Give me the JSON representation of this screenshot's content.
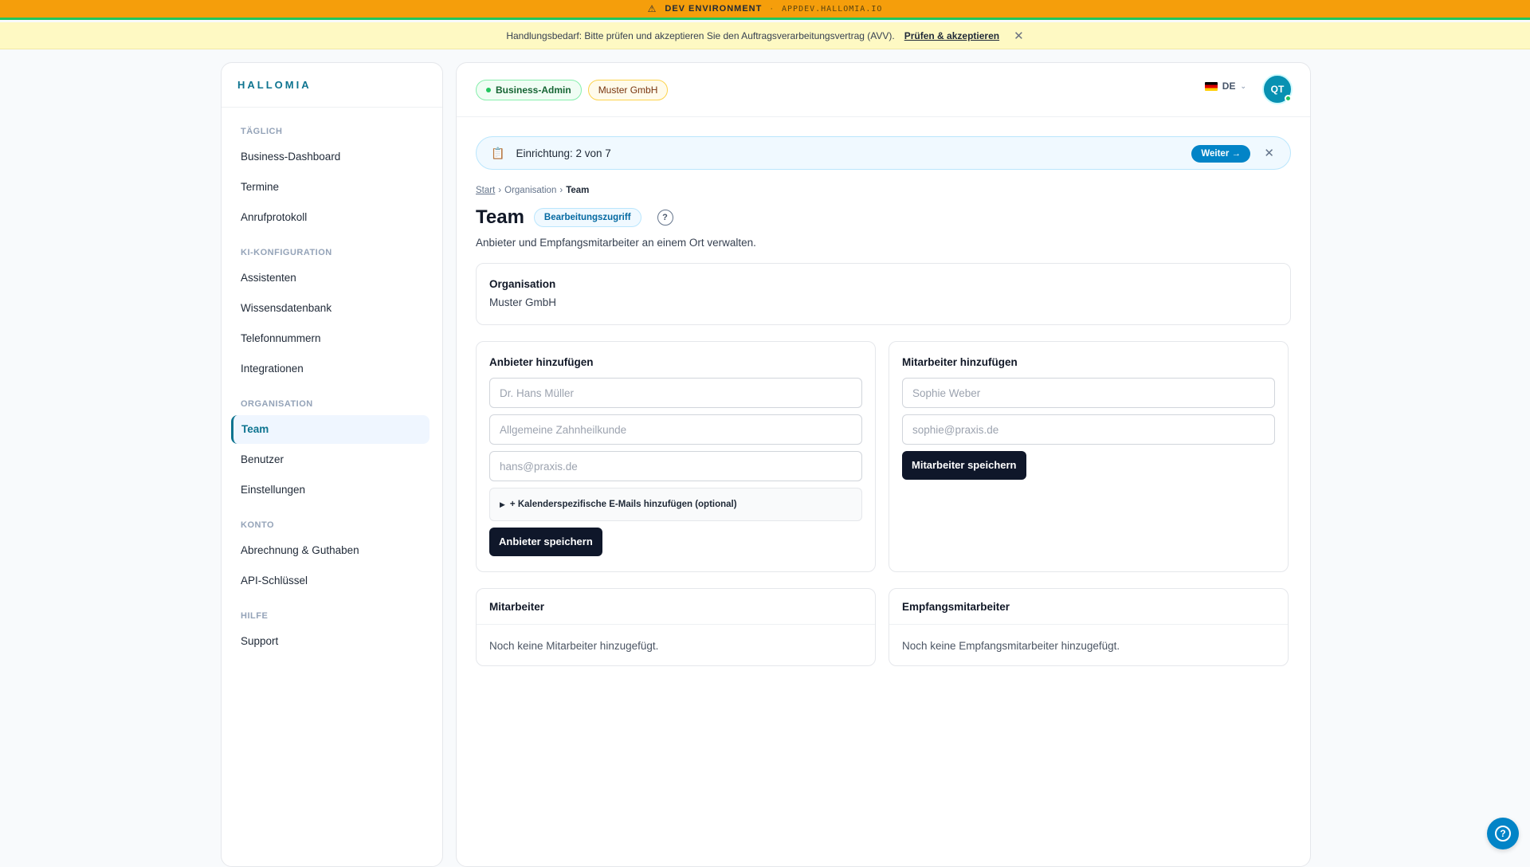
{
  "dev_banner": {
    "warning_symbol": "⚠",
    "label": "DEV ENVIRONMENT",
    "separator": "·",
    "host": "APPDEV.HALLOMIA.IO"
  },
  "notice": {
    "text": "Handlungsbedarf: Bitte prüfen und akzeptieren Sie den Auftragsverarbeitungsvertrag (AVV).",
    "link": "Prüfen & akzeptieren",
    "close": "✕"
  },
  "sidebar": {
    "brand": "HALLOMIA",
    "sections": [
      {
        "title": "TÄGLICH",
        "items": [
          "Business-Dashboard",
          "Termine",
          "Anrufprotokoll"
        ]
      },
      {
        "title": "KI-KONFIGURATION",
        "items": [
          "Assistenten",
          "Wissensdatenbank",
          "Telefonnummern",
          "Integrationen"
        ]
      },
      {
        "title": "ORGANISATION",
        "items": [
          "Team",
          "Benutzer",
          "Einstellungen"
        ]
      },
      {
        "title": "KONTO",
        "items": [
          "Abrechnung & Guthaben",
          "API-Schlüssel"
        ]
      },
      {
        "title": "HILFE",
        "items": [
          "Support"
        ]
      }
    ],
    "active_item": "Team"
  },
  "topbar": {
    "role_badge": "Business-Admin",
    "company_badge": "Muster GmbH",
    "language": "DE",
    "avatar_initials": "QT"
  },
  "setup": {
    "label": "Einrichtung: 2 von 7",
    "next_button": "Weiter →",
    "close": "✕"
  },
  "breadcrumb": {
    "items": [
      "Start",
      "Organisation",
      "Team"
    ],
    "separator": "›"
  },
  "page": {
    "title": "Team",
    "access_badge": "Bearbeitungszugriff",
    "help": "?",
    "subtitle": "Anbieter und Empfangsmitarbeiter an einem Ort verwalten."
  },
  "org_card": {
    "heading": "Organisation",
    "value": "Muster GmbH"
  },
  "provider_form": {
    "heading": "Anbieter hinzufügen",
    "name_placeholder": "Dr. Hans Müller",
    "specialty_placeholder": "Allgemeine Zahnheilkunde",
    "email_placeholder": "hans@praxis.de",
    "details_toggle": "+ Kalenderspezifische E-Mails hinzufügen (optional)",
    "save_button": "Anbieter speichern"
  },
  "staff_form": {
    "heading": "Mitarbeiter hinzufügen",
    "name_placeholder": "Sophie Weber",
    "email_placeholder": "sophie@praxis.de",
    "save_button": "Mitarbeiter speichern"
  },
  "staff_list": {
    "heading": "Mitarbeiter",
    "empty": "Noch keine Mitarbeiter hinzugefügt."
  },
  "reception_list": {
    "heading": "Empfangsmitarbeiter",
    "empty": "Noch keine Empfangsmitarbeiter hinzugefügt."
  },
  "colors": {
    "dev_bar": "#f59e0b",
    "accent": "#0e7490",
    "primary_button": "#0f172a",
    "next_button": "#0284c7"
  },
  "icons": [
    "warning-icon",
    "close-icon",
    "clipboard-icon",
    "help-circle-icon",
    "chevron-down-icon",
    "germany-flag-icon",
    "disclosure-triangle-icon"
  ]
}
